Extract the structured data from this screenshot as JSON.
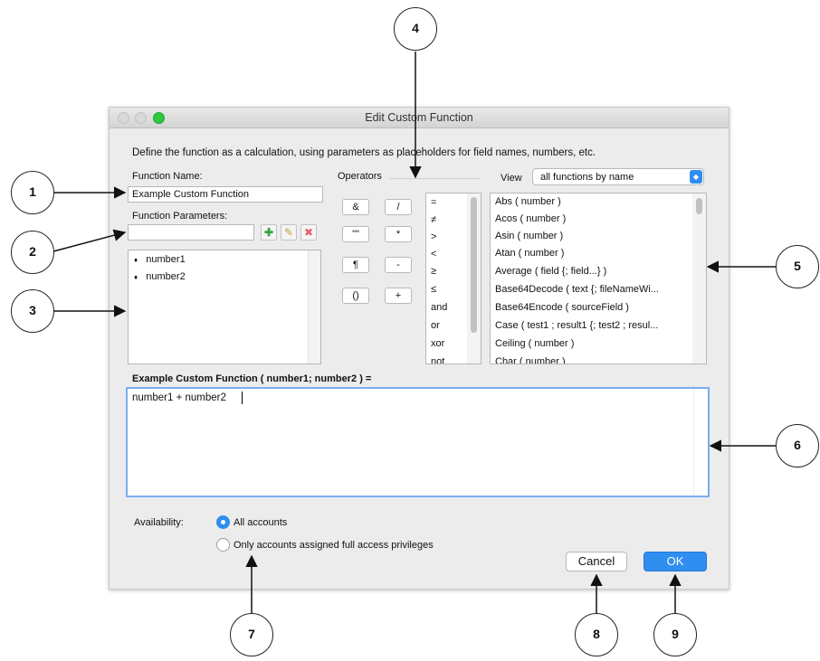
{
  "window": {
    "title": "Edit Custom Function"
  },
  "instructions": "Define the function as a calculation, using parameters as placeholders for field names, numbers, etc.",
  "function_name": {
    "label": "Function Name:",
    "value": "Example Custom Function"
  },
  "parameters": {
    "label": "Function Parameters:",
    "input_value": "",
    "items": [
      "number1",
      "number2"
    ]
  },
  "operators": {
    "label": "Operators",
    "buttons": [
      "&",
      "/",
      "\"\"",
      "*",
      "¶",
      "-",
      "()",
      "+"
    ],
    "list": [
      "=",
      "≠",
      ">",
      "<",
      "≥",
      "≤",
      "and",
      "or",
      "xor",
      "not"
    ]
  },
  "view": {
    "label": "View",
    "selected": "all functions by name",
    "functions": [
      "Abs ( number )",
      "Acos ( number )",
      "Asin ( number )",
      "Atan ( number )",
      "Average ( field {; field...} )",
      "Base64Decode ( text {; fileNameWi...",
      "Base64Encode ( sourceField )",
      "Case ( test1 ; result1 {; test2 ; resul...",
      "Ceiling ( number )",
      "Char ( number )"
    ]
  },
  "formula": {
    "header": "Example Custom Function ( number1; number2 ) =",
    "text": "number1 + number2"
  },
  "availability": {
    "label": "Availability:",
    "options": [
      "All accounts",
      "Only accounts assigned full access privileges"
    ],
    "selected_index": 0
  },
  "buttons": {
    "cancel": "Cancel",
    "ok": "OK"
  },
  "callouts": [
    "1",
    "2",
    "3",
    "4",
    "5",
    "6",
    "7",
    "8",
    "9"
  ],
  "colors": {
    "accent": "#2f8ef0",
    "ok_button": "#2f8ef0",
    "focus_ring": "#7aaef0"
  }
}
